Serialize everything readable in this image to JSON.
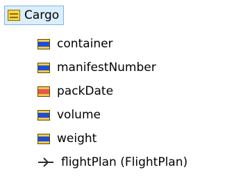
{
  "tree": {
    "root": {
      "label": "Cargo",
      "icon": "class-icon"
    },
    "children": [
      {
        "label": "container",
        "icon": "attribute-icon",
        "color": "#1c4ed8"
      },
      {
        "label": "manifestNumber",
        "icon": "attribute-icon",
        "color": "#1c4ed8"
      },
      {
        "label": "packDate",
        "icon": "attribute-icon",
        "color": "#e8564b"
      },
      {
        "label": "volume",
        "icon": "attribute-icon",
        "color": "#1c4ed8"
      },
      {
        "label": "weight",
        "icon": "attribute-icon",
        "color": "#1c4ed8"
      },
      {
        "label": "flightPlan (FlightPlan)",
        "icon": "association-icon"
      }
    ]
  }
}
